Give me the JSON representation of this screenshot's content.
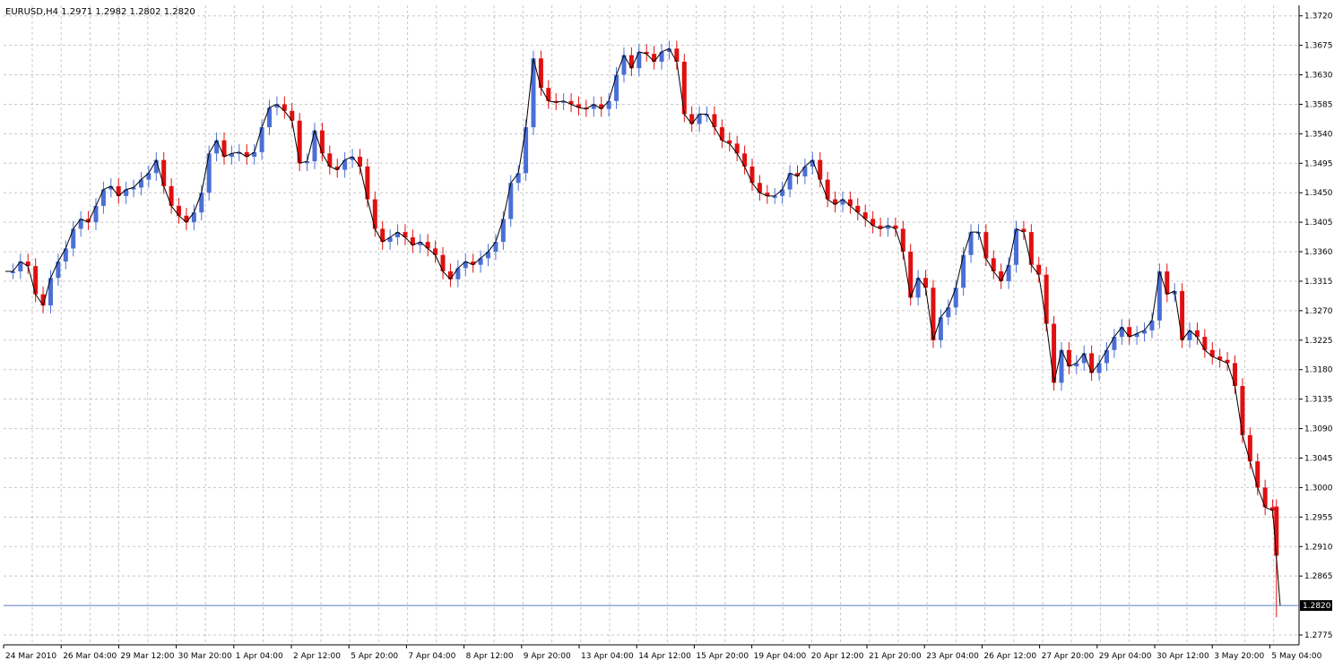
{
  "chart_data": {
    "type": "candlestick",
    "title": "EURUSD,H4  1.2971 1.2982 1.2802 1.2820",
    "symbol": "EURUSD",
    "timeframe": "H4",
    "last_bar": {
      "open": 1.2971,
      "high": 1.2982,
      "low": 1.2802,
      "close": 1.282
    },
    "current_price_label": "1.2820",
    "ylim": [
      1.276,
      1.3736
    ],
    "y_ticks": [
      "1.3720",
      "1.3675",
      "1.3630",
      "1.3585",
      "1.3540",
      "1.3495",
      "1.3450",
      "1.3405",
      "1.3360",
      "1.3315",
      "1.3270",
      "1.3225",
      "1.3180",
      "1.3135",
      "1.3090",
      "1.3045",
      "1.3000",
      "1.2955",
      "1.2910",
      "1.2865",
      "1.2775"
    ],
    "x_ticks": [
      "24 Mar 2010",
      "26 Mar 04:00",
      "29 Mar 12:00",
      "30 Mar 20:00",
      "1 Apr 04:00",
      "2 Apr 12:00",
      "5 Apr 20:00",
      "7 Apr 04:00",
      "8 Apr 12:00",
      "9 Apr 20:00",
      "13 Apr 04:00",
      "14 Apr 12:00",
      "15 Apr 20:00",
      "19 Apr 04:00",
      "20 Apr 12:00",
      "21 Apr 20:00",
      "23 Apr 04:00",
      "26 Apr 12:00",
      "27 Apr 20:00",
      "29 Apr 04:00",
      "30 Apr 12:00",
      "3 May 20:00",
      "5 May 04:00"
    ],
    "grid": true,
    "colors": {
      "bull": "#4a6fd6",
      "bear": "#e01010",
      "line": "#000000",
      "grid": "#c8c8c8",
      "price_line": "#5b7bbf",
      "price_label_bg": "#000000",
      "price_label_fg": "#ffffff"
    },
    "series": [
      {
        "type": "line",
        "values": [
          1.333,
          1.333,
          1.3345,
          1.3338,
          1.3295,
          1.3278,
          1.332,
          1.3345,
          1.3365,
          1.3395,
          1.341,
          1.3405,
          1.343,
          1.3455,
          1.346,
          1.3445,
          1.3455,
          1.3458,
          1.347,
          1.348,
          1.35,
          1.346,
          1.343,
          1.3415,
          1.3405,
          1.342,
          1.345,
          1.351,
          1.353,
          1.3505,
          1.351,
          1.3512,
          1.3505,
          1.3512,
          1.355,
          1.358,
          1.3585,
          1.3575,
          1.356,
          1.3495,
          1.3498,
          1.3545,
          1.351,
          1.349,
          1.3485,
          1.35,
          1.3505,
          1.349,
          1.344,
          1.3395,
          1.3375,
          1.3382,
          1.339,
          1.3382,
          1.337,
          1.3375,
          1.3365,
          1.3355,
          1.333,
          1.3318,
          1.3335,
          1.3345,
          1.334,
          1.335,
          1.336,
          1.3375,
          1.341,
          1.3465,
          1.348,
          1.355,
          1.3655,
          1.361,
          1.359,
          1.3588,
          1.359,
          1.3585,
          1.358,
          1.3578,
          1.3585,
          1.3578,
          1.359,
          1.363,
          1.366,
          1.364,
          1.3665,
          1.3662,
          1.365,
          1.3665,
          1.367,
          1.365,
          1.357,
          1.3555,
          1.357,
          1.357,
          1.355,
          1.353,
          1.3525,
          1.351,
          1.349,
          1.3465,
          1.345,
          1.3445,
          1.3445,
          1.3455,
          1.348,
          1.3475,
          1.349,
          1.35,
          1.347,
          1.344,
          1.3432,
          1.344,
          1.343,
          1.342,
          1.341,
          1.34,
          1.3395,
          1.34,
          1.3395,
          1.336,
          1.329,
          1.332,
          1.3305,
          1.3225,
          1.326,
          1.3275,
          1.3305,
          1.3355,
          1.339,
          1.339,
          1.335,
          1.333,
          1.3315,
          1.334,
          1.3395,
          1.339,
          1.334,
          1.3325,
          1.325,
          1.316,
          1.321,
          1.3185,
          1.319,
          1.3205,
          1.3175,
          1.319,
          1.321,
          1.323,
          1.3245,
          1.323,
          1.3235,
          1.324,
          1.3255,
          1.333,
          1.3295,
          1.33,
          1.3225,
          1.324,
          1.323,
          1.321,
          1.32,
          1.3195,
          1.319,
          1.3155,
          1.308,
          1.304,
          1.3,
          1.297,
          1.2965,
          1.282
        ]
      }
    ]
  }
}
